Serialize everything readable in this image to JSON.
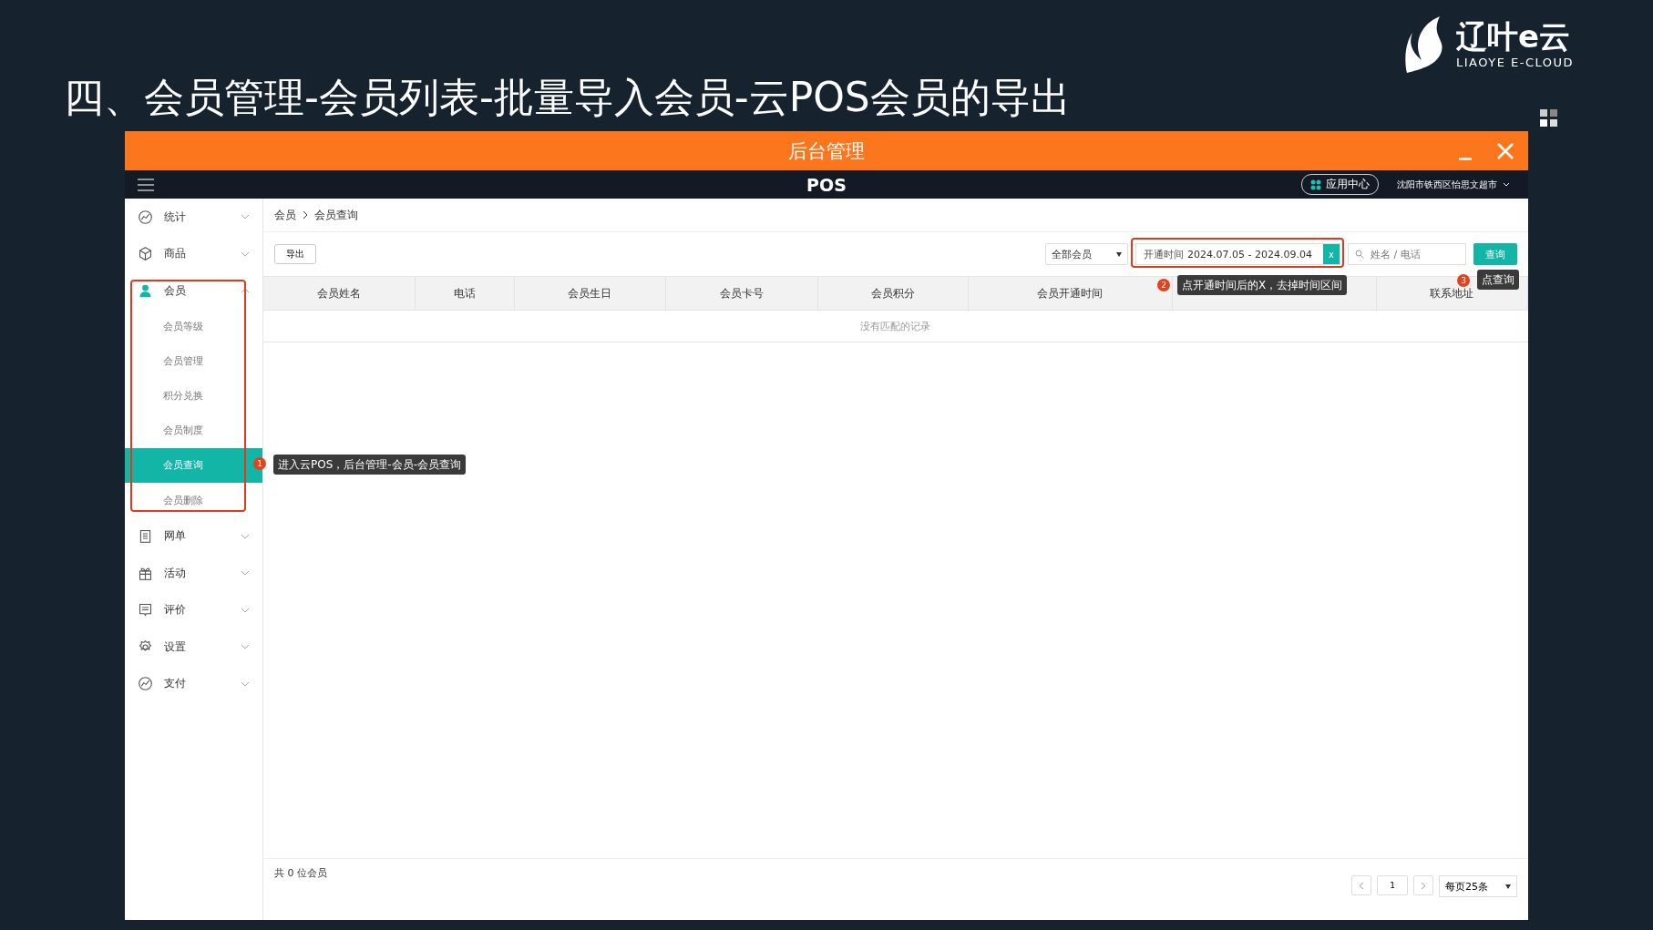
{
  "slide": {
    "title": "四、会员管理-会员列表-批量导入会员-云POS会员的导出",
    "logo": {
      "name": "辽叶e云",
      "tagline": "LIAOYE E-CLOUD"
    }
  },
  "window": {
    "title": "后台管理"
  },
  "topbar": {
    "brand": "POS",
    "app_center": "应用中心",
    "store": "沈阳市铁西区怡思文超市"
  },
  "sidebar": {
    "items": [
      {
        "label": "统计",
        "expanded": false
      },
      {
        "label": "商品",
        "expanded": false
      },
      {
        "label": "会员",
        "expanded": true,
        "children": [
          {
            "label": "会员等级",
            "selected": false
          },
          {
            "label": "会员管理",
            "selected": false
          },
          {
            "label": "积分兑换",
            "selected": false
          },
          {
            "label": "会员制度",
            "selected": false
          },
          {
            "label": "会员查询",
            "selected": true
          },
          {
            "label": "会员删除",
            "selected": false
          }
        ]
      },
      {
        "label": "网单",
        "expanded": false
      },
      {
        "label": "活动",
        "expanded": false
      },
      {
        "label": "评价",
        "expanded": false
      },
      {
        "label": "设置",
        "expanded": false
      },
      {
        "label": "支付",
        "expanded": false
      }
    ]
  },
  "breadcrumb": [
    "会员",
    "会员查询"
  ],
  "toolbar": {
    "export": "导出",
    "filter": "全部会员",
    "date_field": {
      "label": "开通时间",
      "value": "2024.07.05 - 2024.09.04",
      "clear": "x"
    },
    "search": {
      "placeholder": "姓名 / 电话"
    },
    "query": "查询"
  },
  "table": {
    "columns": [
      "会员姓名",
      "电话",
      "会员生日",
      "会员卡号",
      "会员积分",
      "会员开通时间",
      "",
      "联系地址"
    ],
    "empty_message": "没有匹配的记录"
  },
  "footer": {
    "total": "共 0 位会员",
    "page": "1",
    "page_size": "每页25条"
  },
  "annotations": [
    {
      "number": "1",
      "text": "进入云POS，后台管理-会员-会员查询"
    },
    {
      "number": "2",
      "text": "点开通时间后的X，去掉时间区间"
    },
    {
      "number": "3",
      "text": "点查询"
    }
  ]
}
